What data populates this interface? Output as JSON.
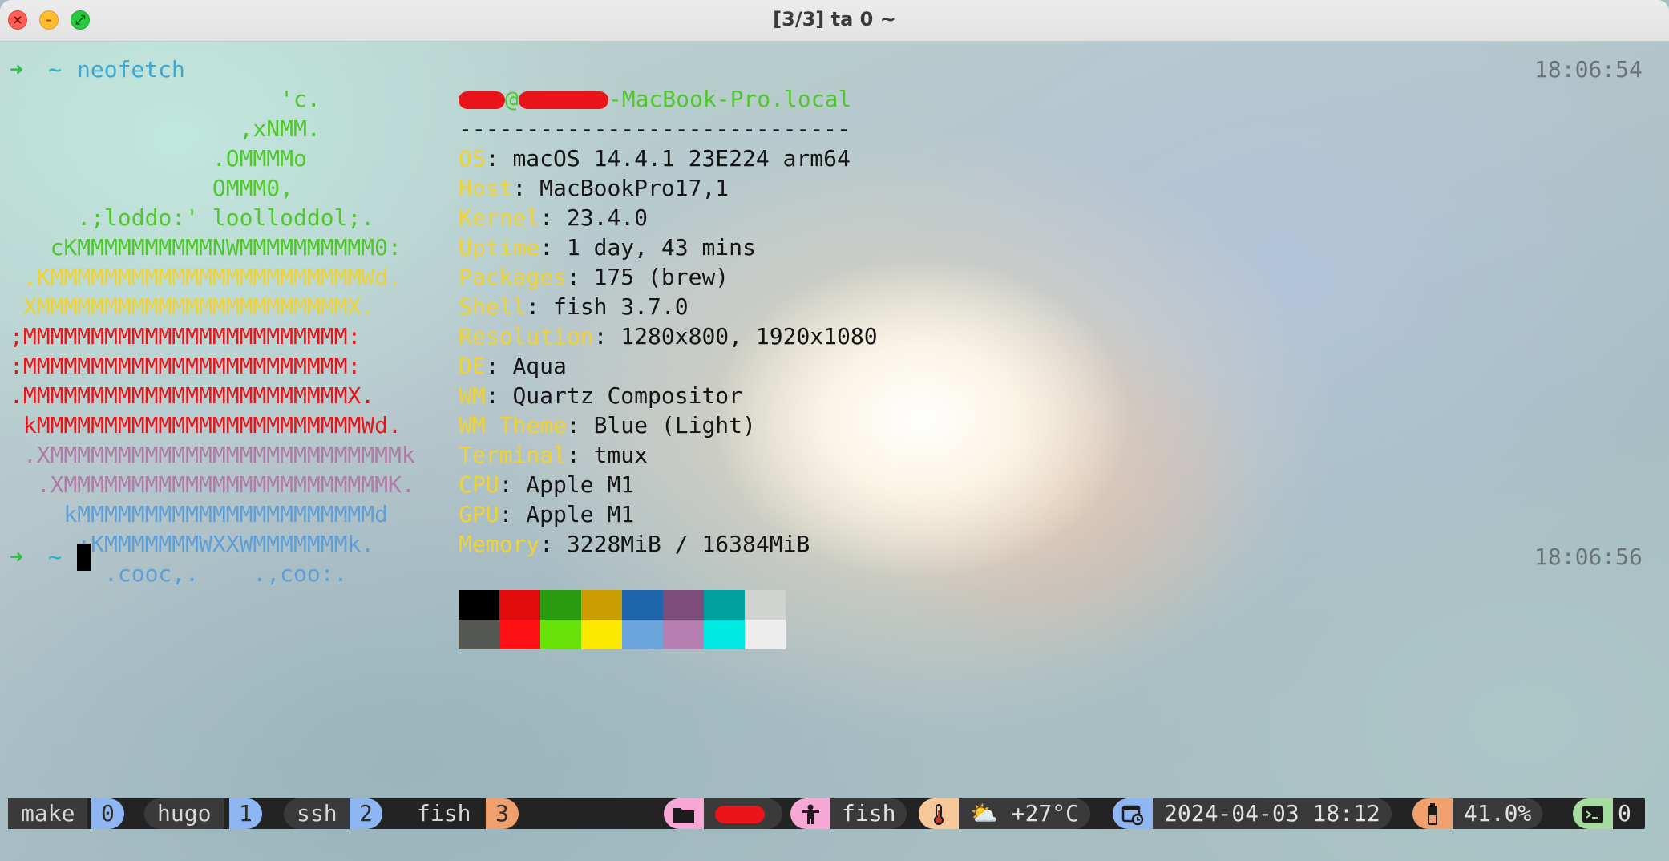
{
  "window": {
    "title": "[3/3] ta 0 ~"
  },
  "prompt1": {
    "arrow": "➜",
    "tilde": "~",
    "command": "neofetch",
    "time": "18:06:54"
  },
  "art": [
    {
      "text": "                    'c.",
      "color": "#4fc929"
    },
    {
      "text": "                 ,xNMM.",
      "color": "#4fc929"
    },
    {
      "text": "               .OMMMMo",
      "color": "#4fc929"
    },
    {
      "text": "               OMMM0,",
      "color": "#4fc929"
    },
    {
      "text": "     .;loddo:' loolloddol;.",
      "color": "#4fc929"
    },
    {
      "text": "   cKMMMMMMMMMMNWMMMMMMMMMM0:",
      "color": "#4fc929"
    },
    {
      "text": " .KMMMMMMMMMMMMMMMMMMMMMMMWd.",
      "color": "#f2d22e"
    },
    {
      "text": " XMMMMMMMMMMMMMMMMMMMMMMMX.",
      "color": "#f2d22e"
    },
    {
      "text": ";MMMMMMMMMMMMMMMMMMMMMMMM:",
      "color": "#e8141a"
    },
    {
      "text": ":MMMMMMMMMMMMMMMMMMMMMMMM:",
      "color": "#e8141a"
    },
    {
      "text": ".MMMMMMMMMMMMMMMMMMMMMMMMX.",
      "color": "#e8141a"
    },
    {
      "text": " kMMMMMMMMMMMMMMMMMMMMMMMMWd.",
      "color": "#e8141a"
    },
    {
      "text": " .XMMMMMMMMMMMMMMMMMMMMMMMMMMk",
      "color": "#b07ba8"
    },
    {
      "text": "  .XMMMMMMMMMMMMMMMMMMMMMMMMK.",
      "color": "#b07ba8"
    },
    {
      "text": "    kMMMMMMMMMMMMMMMMMMMMMMd",
      "color": "#5f9fd7"
    },
    {
      "text": "     ;KMMMMMMMWXXWMMMMMMMk.",
      "color": "#5f9fd7"
    },
    {
      "text": "       .cooc,.    .,coo:.",
      "color": "#5f9fd7"
    }
  ],
  "host": {
    "domain": "-MacBook-Pro.local",
    "separator": "-----------------------------"
  },
  "info": [
    {
      "key": "OS",
      "value": "macOS 14.4.1 23E224 arm64"
    },
    {
      "key": "Host",
      "value": "MacBookPro17,1"
    },
    {
      "key": "Kernel",
      "value": "23.4.0"
    },
    {
      "key": "Uptime",
      "value": "1 day, 43 mins"
    },
    {
      "key": "Packages",
      "value": "175 (brew)"
    },
    {
      "key": "Shell",
      "value": "fish 3.7.0"
    },
    {
      "key": "Resolution",
      "value": "1280x800, 1920x1080"
    },
    {
      "key": "DE",
      "value": "Aqua"
    },
    {
      "key": "WM",
      "value": "Quartz Compositor"
    },
    {
      "key": "WM Theme",
      "value": "Blue (Light)"
    },
    {
      "key": "Terminal",
      "value": "tmux"
    },
    {
      "key": "CPU",
      "value": "Apple M1"
    },
    {
      "key": "GPU",
      "value": "Apple M1"
    },
    {
      "key": "Memory",
      "value": "3228MiB / 16384MiB"
    }
  ],
  "palette": {
    "normal": [
      "#000000",
      "#df0b0c",
      "#2a9a10",
      "#c99c00",
      "#1e65ac",
      "#7c4d7a",
      "#00a19f",
      "#d0d3cf"
    ],
    "bright": [
      "#555753",
      "#fe0f13",
      "#68e30a",
      "#fde800",
      "#6ca5db",
      "#b67fb2",
      "#00e9e2",
      "#ececec"
    ]
  },
  "prompt2": {
    "arrow": "➜",
    "tilde": "~",
    "time": "18:06:56"
  },
  "tmux": {
    "windows": [
      {
        "name": "make",
        "index": "0"
      },
      {
        "name": "hugo",
        "index": "1"
      },
      {
        "name": "ssh",
        "index": "2"
      },
      {
        "name": "fish",
        "index": "3"
      }
    ],
    "status": {
      "process": "fish",
      "weather": "⛅ +27°C",
      "datetime": "2024-04-03 18:12",
      "battery": "41.0%",
      "session": "0"
    },
    "icons": [
      "folder-icon",
      "person-icon",
      "thermometer-icon",
      "calendar-clock-icon",
      "battery-icon",
      "terminal-icon"
    ],
    "colors": {
      "folder": "#f7a8d4",
      "person": "#f7a8d4",
      "thermo": "#f8c79a",
      "calendar": "#8eb6f3",
      "battery": "#f0a06d",
      "terminal": "#a6dca0"
    }
  }
}
